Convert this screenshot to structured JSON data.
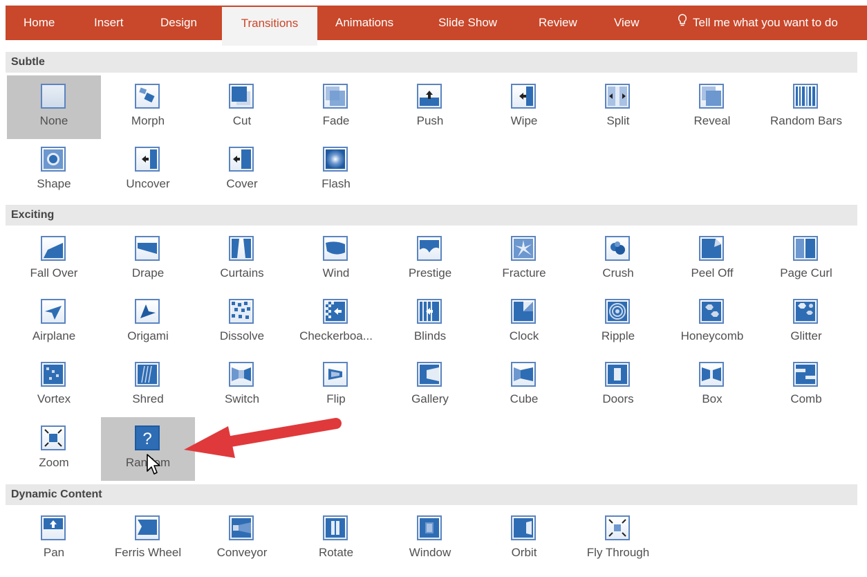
{
  "ribbon": {
    "tabs": [
      "Home",
      "Insert",
      "Design",
      "Transitions",
      "Animations",
      "Slide Show",
      "Review",
      "View"
    ],
    "tell_me": "Tell me what you want to do"
  },
  "sections": {
    "subtle": "Subtle",
    "exciting": "Exciting",
    "dynamic": "Dynamic Content"
  },
  "subtle": {
    "none": "None",
    "morph": "Morph",
    "cut": "Cut",
    "fade": "Fade",
    "push": "Push",
    "wipe": "Wipe",
    "split": "Split",
    "reveal": "Reveal",
    "random_bars": "Random Bars",
    "shape": "Shape",
    "uncover": "Uncover",
    "cover": "Cover",
    "flash": "Flash"
  },
  "exciting": {
    "fall_over": "Fall Over",
    "drape": "Drape",
    "curtains": "Curtains",
    "wind": "Wind",
    "prestige": "Prestige",
    "fracture": "Fracture",
    "crush": "Crush",
    "peel_off": "Peel Off",
    "page_curl": "Page Curl",
    "airplane": "Airplane",
    "origami": "Origami",
    "dissolve": "Dissolve",
    "checkerboard": "Checkerboa...",
    "blinds": "Blinds",
    "clock": "Clock",
    "ripple": "Ripple",
    "honeycomb": "Honeycomb",
    "glitter": "Glitter",
    "vortex": "Vortex",
    "shred": "Shred",
    "switch": "Switch",
    "flip": "Flip",
    "gallery": "Gallery",
    "cube": "Cube",
    "doors": "Doors",
    "box": "Box",
    "comb": "Comb",
    "zoom": "Zoom",
    "random": "Random"
  },
  "dynamic": {
    "pan": "Pan",
    "ferris_wheel": "Ferris Wheel",
    "conveyor": "Conveyor",
    "rotate": "Rotate",
    "window": "Window",
    "orbit": "Orbit",
    "fly_through": "Fly Through"
  },
  "colors": {
    "ribbon": "#c9472a",
    "icon_blue": "#2e6db4",
    "arrow": "#e0393b"
  },
  "random_glyph": "?"
}
